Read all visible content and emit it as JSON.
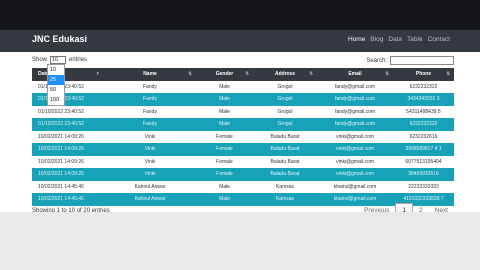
{
  "navbar": {
    "brand": "JNC Edukasi",
    "links": [
      {
        "label": "Home",
        "active": true
      },
      {
        "label": "Blog",
        "active": false
      },
      {
        "label": "Data",
        "active": false
      },
      {
        "label": "Table",
        "active": false
      },
      {
        "label": "Contact",
        "active": false
      }
    ]
  },
  "table_controls": {
    "show_label": "Show",
    "entries_value": "10",
    "entries_label": "entries",
    "length_options": [
      "10",
      "25",
      "50",
      "100"
    ],
    "length_options_selected": "25",
    "search_label": "Search:",
    "search_value": ""
  },
  "table": {
    "columns": [
      "Dated",
      "Name",
      "Gender",
      "Address",
      "Email",
      "Phone"
    ],
    "rows": [
      [
        "01/10/2022 23:40:52",
        "Fandy",
        "Male",
        "Grogol",
        "fandy@gmail.com",
        "6232232322"
      ],
      [
        "01/10/2022 23:40:52",
        "Fandy",
        "Male",
        "Grogol",
        "fandy@gmail.com",
        "3434343232 3"
      ],
      [
        "01/10/2022 23:40:52",
        "Fandy",
        "Male",
        "Grogol",
        "fandy@gmail.com",
        "54311498439 5"
      ],
      [
        "01/10/2022 23:40:52",
        "Fandy",
        "Male",
        "Grogol",
        "fandy@gmail.com",
        "6232232322"
      ],
      [
        "10/02/2021 14:09:26",
        "Vinki",
        "Female",
        "Baladu Barat",
        "vinki@gmail.com",
        "6232232616"
      ],
      [
        "10/02/2021 14:09:26",
        "Vinki",
        "Female",
        "Baladu Barat",
        "vinki@gmail.com",
        "3998589817 4 1"
      ],
      [
        "10/02/2021 14:09:26",
        "Vinki",
        "Female",
        "Baladu Barat",
        "vinki@gmail.com",
        "6077513195404"
      ],
      [
        "10/02/2021 14:09:26",
        "Vinki",
        "Female",
        "Baladu Barat",
        "vinki@gmail.com",
        "38499933516"
      ],
      [
        "10/02/2021 14:45:46",
        "Kahirul Anwar",
        "Male",
        "Kamsas",
        "khairul@gmail.com",
        "22233333333"
      ],
      [
        "10/02/2021 14:45:46",
        "Kahirul Anwar",
        "Male",
        "Kamsas",
        "khairul@gmail.com",
        "4191032333838 7"
      ]
    ]
  },
  "footer": {
    "info": "Showing 1 to 10 of 20 entries",
    "previous_label": "Previous",
    "pages": [
      "1",
      "2"
    ],
    "current_page": "1",
    "next_label": "Next"
  }
}
